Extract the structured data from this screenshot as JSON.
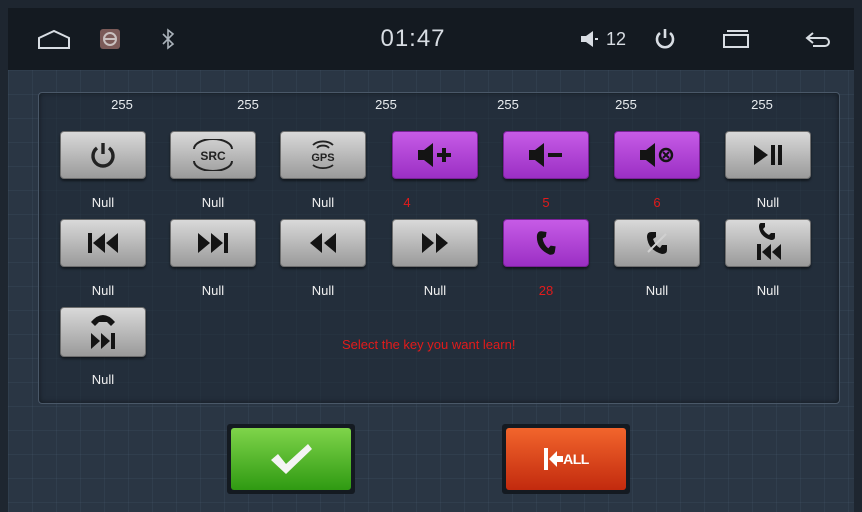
{
  "statusbar": {
    "home_icon": "home-outline-icon",
    "app_icon": "steering-wheel-app-icon",
    "bluetooth_icon": "bluetooth-icon",
    "time": "01:47",
    "volume_icon": "speaker-icon",
    "volume": "12",
    "power_icon": "power-icon",
    "recents_icon": "recent-apps-icon",
    "back_icon": "back-arrow-icon"
  },
  "top_values": [
    "255",
    "255",
    "255",
    "255",
    "255",
    "255"
  ],
  "keys": [
    {
      "icon": "power-icon",
      "label": "Null",
      "active": false
    },
    {
      "icon": "src-icon",
      "text": "SRC",
      "label": "Null",
      "active": false
    },
    {
      "icon": "gps-icon",
      "text": "GPS",
      "label": "Null",
      "active": false
    },
    {
      "icon": "volume-up-icon",
      "label": "4",
      "active": true
    },
    {
      "icon": "volume-down-icon",
      "label": "5",
      "active": true
    },
    {
      "icon": "mute-icon",
      "label": "6",
      "active": true
    },
    {
      "icon": "play-pause-icon",
      "label": "Null",
      "active": false
    },
    {
      "icon": "previous-track-icon",
      "label": "Null",
      "active": false
    },
    {
      "icon": "next-track-icon",
      "label": "Null",
      "active": false
    },
    {
      "icon": "rewind-icon",
      "label": "Null",
      "active": false
    },
    {
      "icon": "fast-forward-icon",
      "label": "Null",
      "active": false
    },
    {
      "icon": "phone-answer-icon",
      "label": "28",
      "active": true
    },
    {
      "icon": "phone-hangup-icon",
      "label": "Null",
      "active": false
    },
    {
      "icon": "phone-previous-icon",
      "label": "Null",
      "active": false
    },
    {
      "icon": "phone-next-icon",
      "label": "Null",
      "active": false
    }
  ],
  "hint": "Select the key you want learn!",
  "buttons": {
    "confirm_icon": "checkmark-icon",
    "clear_all_label": "ALL",
    "clear_all_icon": "clear-all-arrow-icon"
  },
  "colors": {
    "active_key": "#a83cd0",
    "inactive_key": "#bdbdbd",
    "confirm": "#4cb82a",
    "clear_all": "#e0441c",
    "hint_text": "#e21b1b"
  }
}
